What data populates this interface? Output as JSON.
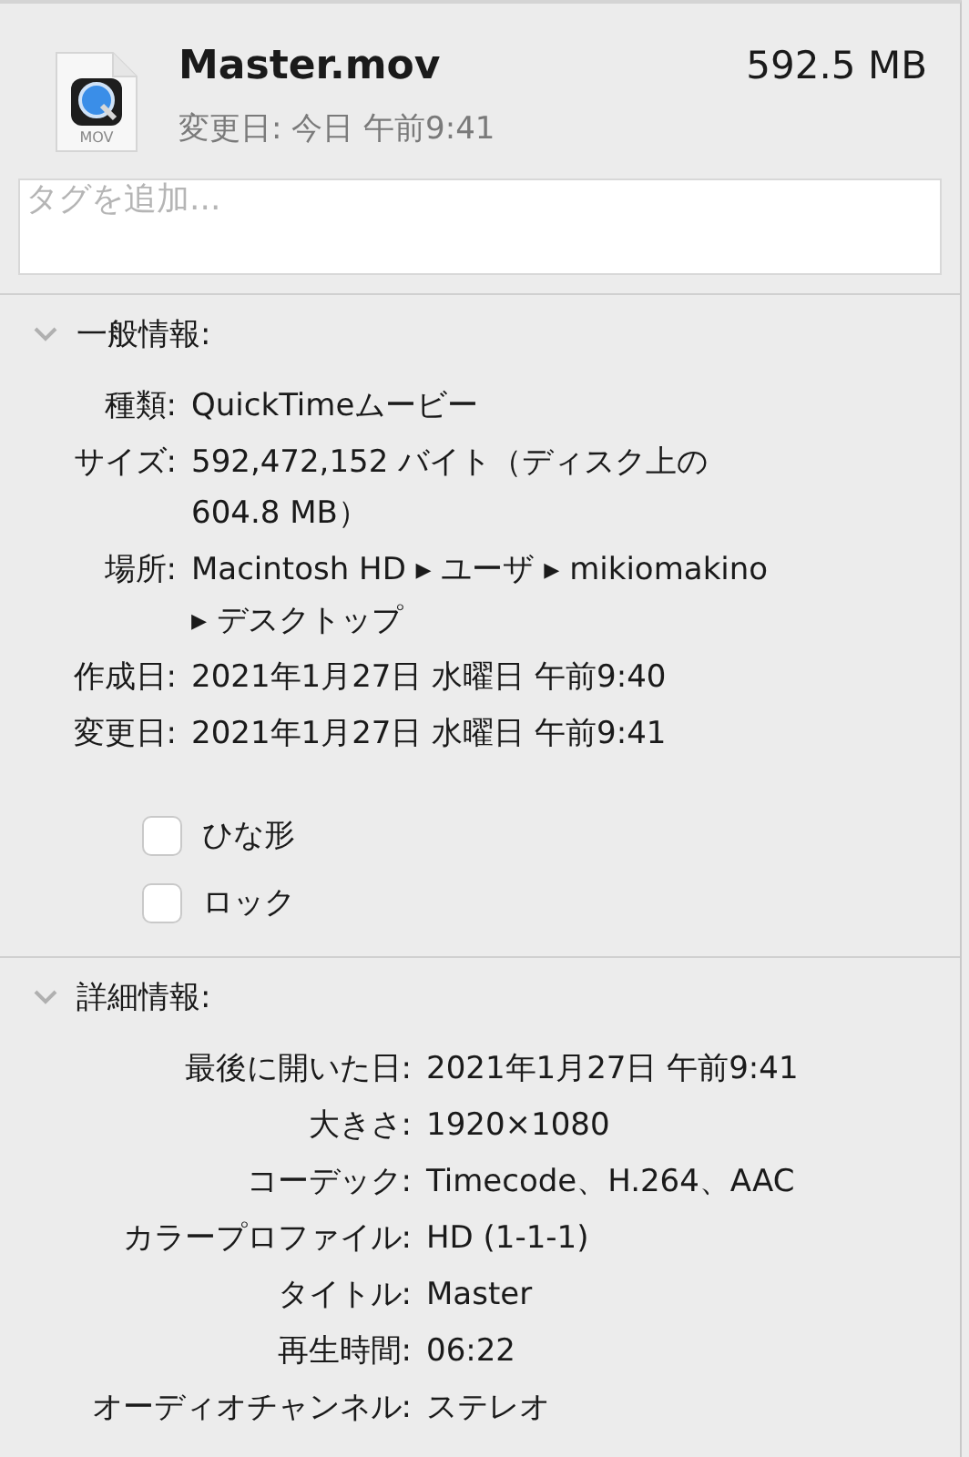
{
  "file": {
    "name": "Master.mov",
    "size": "592.5 MB",
    "modified": "変更日: 今日 午前9:41",
    "icon_label": "MOV"
  },
  "tags": {
    "placeholder": "タグを追加..."
  },
  "general": {
    "title": "一般情報:",
    "expanded": true,
    "rows": [
      {
        "label": "種類:",
        "lines": [
          "QuickTimeムービー"
        ]
      },
      {
        "label": "サイズ:",
        "lines": [
          "592,472,152 バイト（ディスク上の",
          "604.8 MB）"
        ]
      },
      {
        "label": "場所:",
        "lines": [
          "Macintosh HD ▸ ユーザ ▸ mikiomakino",
          "▸ デスクトップ"
        ]
      },
      {
        "label": "作成日:",
        "lines": [
          "2021年1月27日 水曜日 午前9:40"
        ]
      },
      {
        "label": "変更日:",
        "lines": [
          "2021年1月27日 水曜日 午前9:41"
        ]
      }
    ],
    "checkboxes": [
      {
        "label": "ひな形",
        "checked": false
      },
      {
        "label": "ロック",
        "checked": false
      }
    ]
  },
  "details": {
    "title": "詳細情報:",
    "expanded": true,
    "rows": [
      {
        "label": "最後に開いた日:",
        "lines": [
          "2021年1月27日 午前9:41"
        ]
      },
      {
        "label": "大きさ:",
        "lines": [
          "1920×1080"
        ]
      },
      {
        "label": "コーデック:",
        "lines": [
          "Timecode、H.264、AAC"
        ]
      },
      {
        "label": "カラープロファイル:",
        "lines": [
          "HD (1-1-1)"
        ]
      },
      {
        "label": "タイトル:",
        "lines": [
          "Master"
        ]
      },
      {
        "label": "再生時間:",
        "lines": [
          "06:22"
        ]
      },
      {
        "label": "オーディオチャンネル:",
        "lines": [
          "ステレオ"
        ]
      }
    ]
  }
}
